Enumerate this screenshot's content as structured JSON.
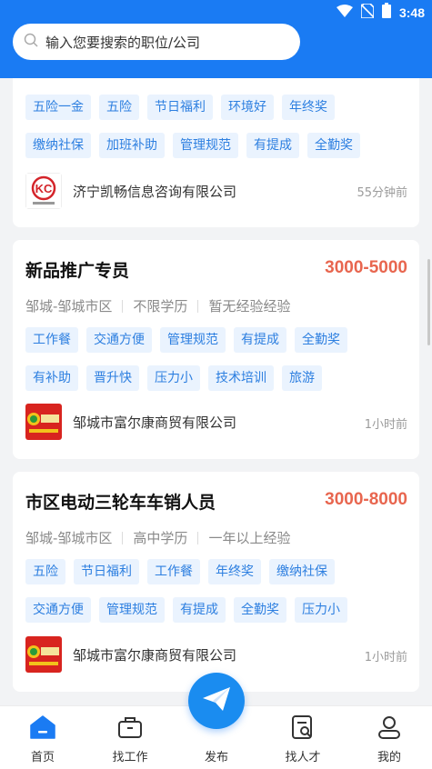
{
  "status": {
    "time": "3:48"
  },
  "search": {
    "placeholder": "输入您要搜索的职位/公司"
  },
  "card0": {
    "tags_row1": [
      "五险一金",
      "五险",
      "节日福利",
      "环境好",
      "年终奖"
    ],
    "tags_row2": [
      "缴纳社保",
      "加班补助",
      "管理规范",
      "有提成",
      "全勤奖"
    ],
    "company": "济宁凯畅信息咨询有限公司",
    "time": "55分钟前"
  },
  "card1": {
    "title": "新品推广专员",
    "salary": "3000-5000",
    "location": "邹城-邹城市区",
    "education": "不限学历",
    "experience": "暂无经验经验",
    "tags_row1": [
      "工作餐",
      "交通方便",
      "管理规范",
      "有提成",
      "全勤奖"
    ],
    "tags_row2": [
      "有补助",
      "晋升快",
      "压力小",
      "技术培训",
      "旅游"
    ],
    "company": "邹城市富尔康商贸有限公司",
    "time": "1小时前"
  },
  "card2": {
    "title": "市区电动三轮车车销人员",
    "salary": "3000-8000",
    "location": "邹城-邹城市区",
    "education": "高中学历",
    "experience": "一年以上经验",
    "tags_row1": [
      "五险",
      "节日福利",
      "工作餐",
      "年终奖",
      "缴纳社保"
    ],
    "tags_row2": [
      "交通方便",
      "管理规范",
      "有提成",
      "全勤奖",
      "压力小"
    ],
    "company": "邹城市富尔康商贸有限公司",
    "time": "1小时前"
  },
  "nav": {
    "home": "首页",
    "find_job": "找工作",
    "publish": "发布",
    "find_talent": "找人才",
    "mine": "我的"
  },
  "colors": {
    "primary": "#1a7bf3",
    "salary": "#e8664f",
    "tag_bg": "#eaf3fe",
    "tag_text": "#2d7fe0"
  }
}
